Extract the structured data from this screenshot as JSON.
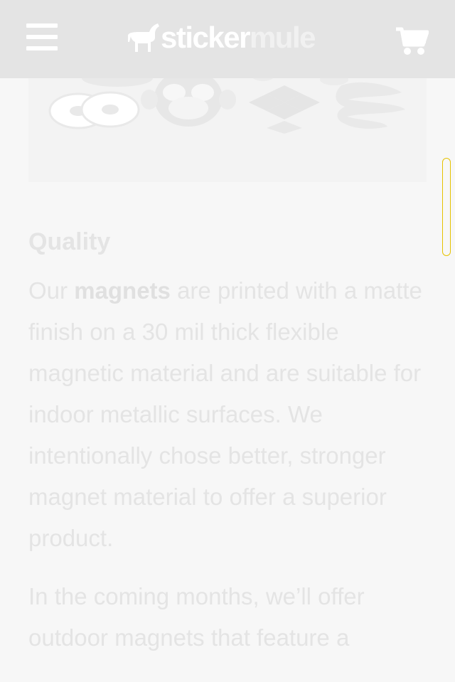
{
  "header": {
    "logo": {
      "sticker": "sticker",
      "mule": "mule"
    },
    "menu_icon": "hamburger-icon",
    "cart_icon": "shopping-cart-icon",
    "background": "#e4e4e4"
  },
  "hero": {
    "description_items": [
      "wheels",
      "monkey-face",
      "dropbox",
      "mud-splash"
    ]
  },
  "content": {
    "heading": "Quality",
    "paragraph1": {
      "before": "Our ",
      "link": "magnets",
      "after": " are printed with a matte finish on a 30 mil thick flexible magnetic material and are suitable for indoor metallic surfaces. We intentionally chose better, stronger magnet material to offer a superior product."
    },
    "paragraph2": "In the coming months, we’ll offer outdoor magnets that feature a"
  },
  "colors": {
    "page_bg": "#f7f7f7",
    "text": "#e4e4e4",
    "scrollbar_border": "#e6c200"
  }
}
